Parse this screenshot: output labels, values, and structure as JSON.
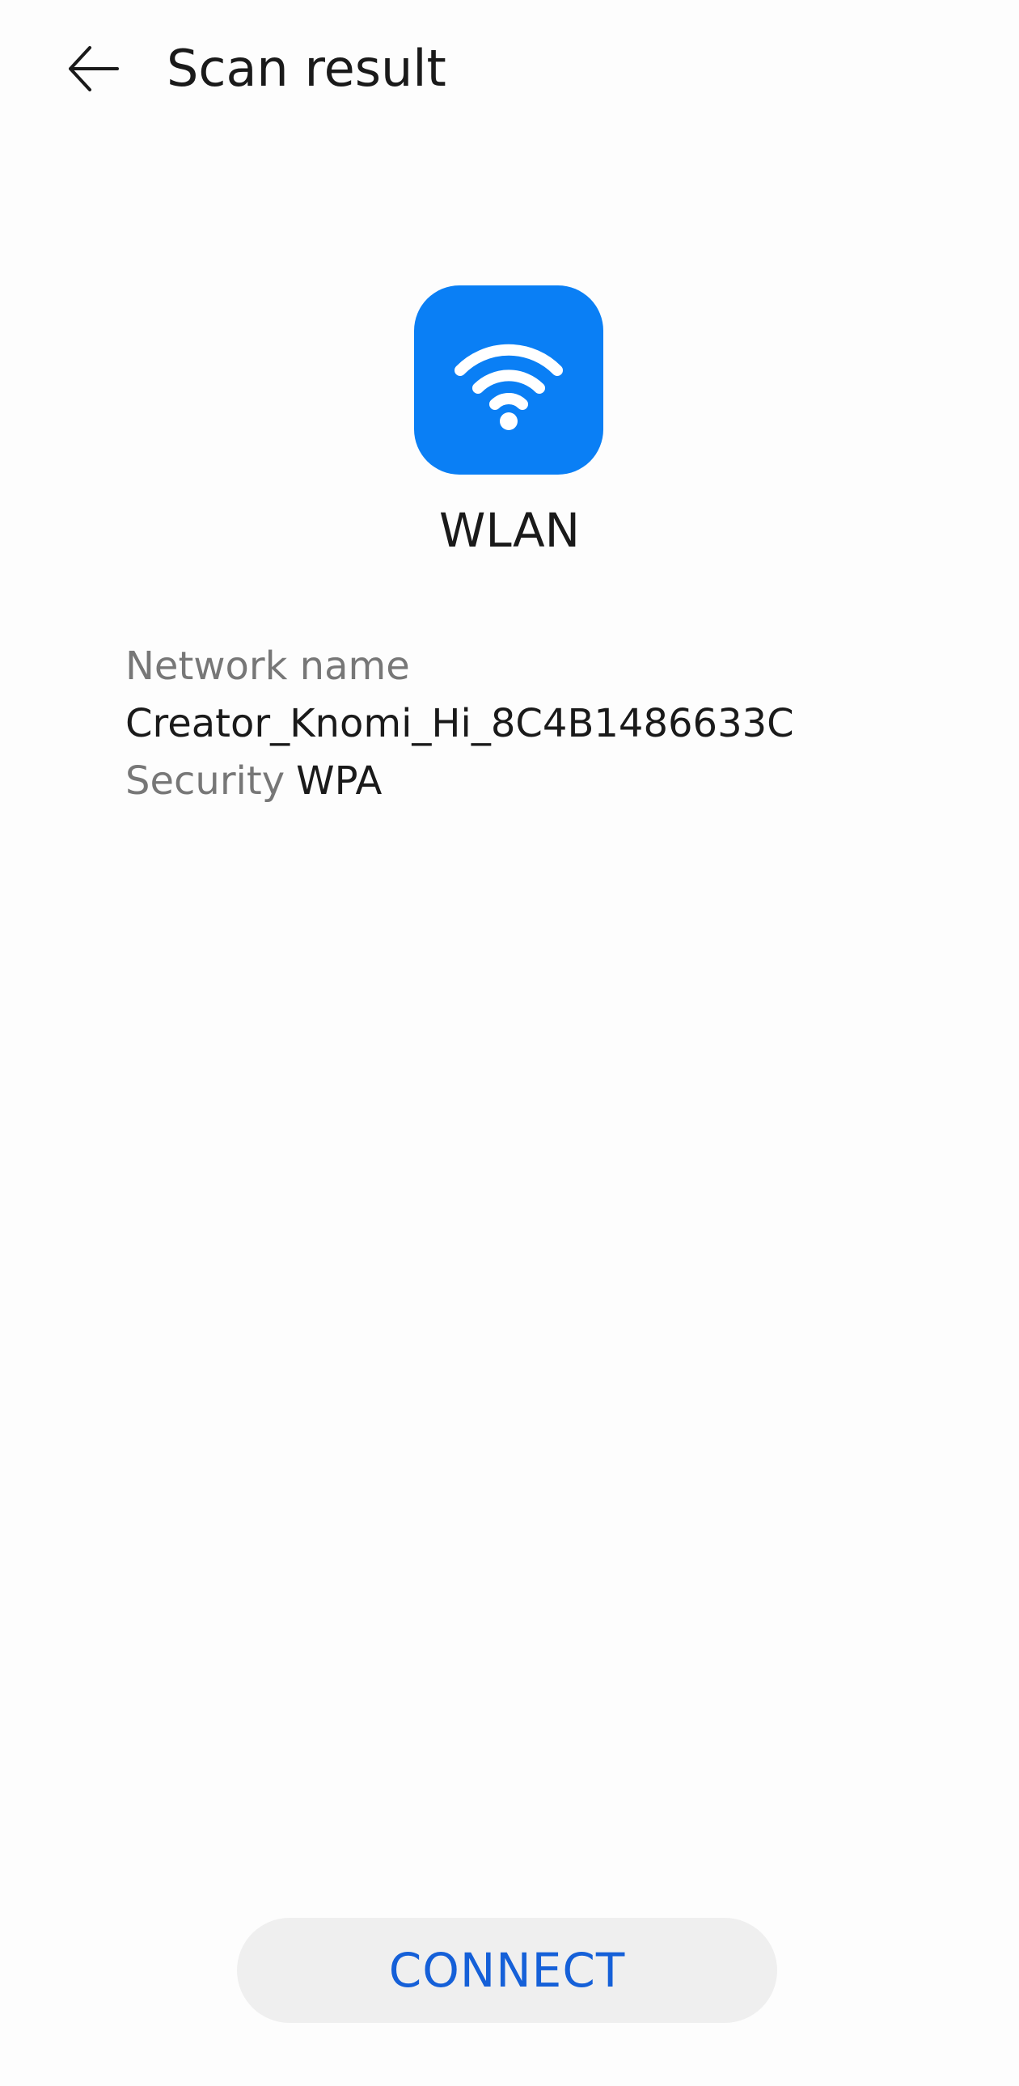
{
  "header": {
    "back_icon": "arrow-left-icon",
    "title": "Scan result"
  },
  "result": {
    "icon": "wifi-icon",
    "icon_bg_color": "#0A7FF5",
    "type_label": "WLAN"
  },
  "network": {
    "name_label": "Network name",
    "name_value": "Creator_Knomi_Hi_8C4B1486633C",
    "security_label": "Security",
    "security_value": "WPA"
  },
  "actions": {
    "connect_label": "CONNECT",
    "connect_color": "#1560D8"
  }
}
